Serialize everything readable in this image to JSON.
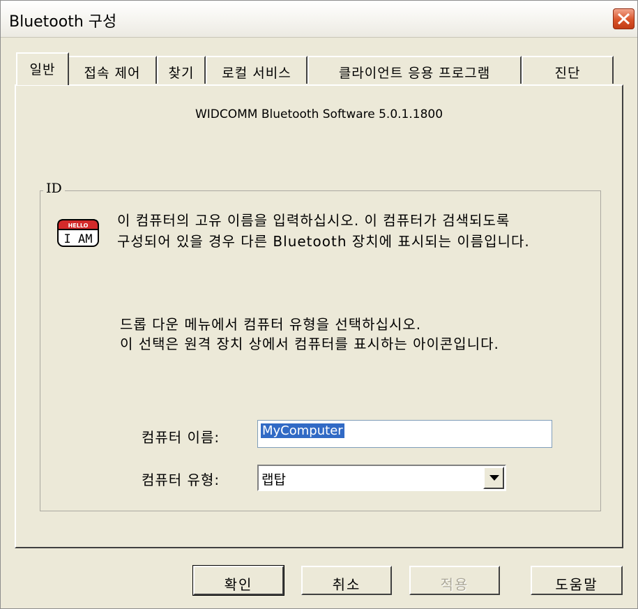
{
  "window": {
    "title": "Bluetooth 구성"
  },
  "tabs": [
    {
      "label": "일반",
      "active": true
    },
    {
      "label": "접속 제어",
      "active": false
    },
    {
      "label": "찾기",
      "active": false
    },
    {
      "label": "로컬 서비스",
      "active": false
    },
    {
      "label": "클라이언트 응용 프로그램",
      "active": false
    },
    {
      "label": "진단",
      "active": false
    }
  ],
  "general": {
    "version": "WIDCOMM Bluetooth Software 5.0.1.1800",
    "group_label": "ID",
    "icon": {
      "name": "hello-i-am-icon",
      "top_text": "HELLO",
      "main_text": "I AM"
    },
    "desc1_line1": "이 컴퓨터의 고유 이름을 입력하십시오. 이 컴퓨터가 검색되도록",
    "desc1_line2": "구성되어 있을 경우 다른 Bluetooth 장치에 표시되는 이름입니다.",
    "desc2_line1": "드롭 다운 메뉴에서 컴퓨터 유형을 선택하십시오.",
    "desc2_line2": "이 선택은 원격 장치 상에서 컴퓨터를 표시하는 아이콘입니다.",
    "name_label": "컴퓨터 이름:",
    "name_value": "MyComputer",
    "type_label": "컴퓨터 유형:",
    "type_value": "랩탑"
  },
  "buttons": {
    "ok": "확인",
    "cancel": "취소",
    "apply": "적용",
    "help": "도움말"
  },
  "colors": {
    "face": "#ece9d8",
    "selection": "#316ac5",
    "close": "#d9542a",
    "icon_red": "#d42a2a"
  }
}
